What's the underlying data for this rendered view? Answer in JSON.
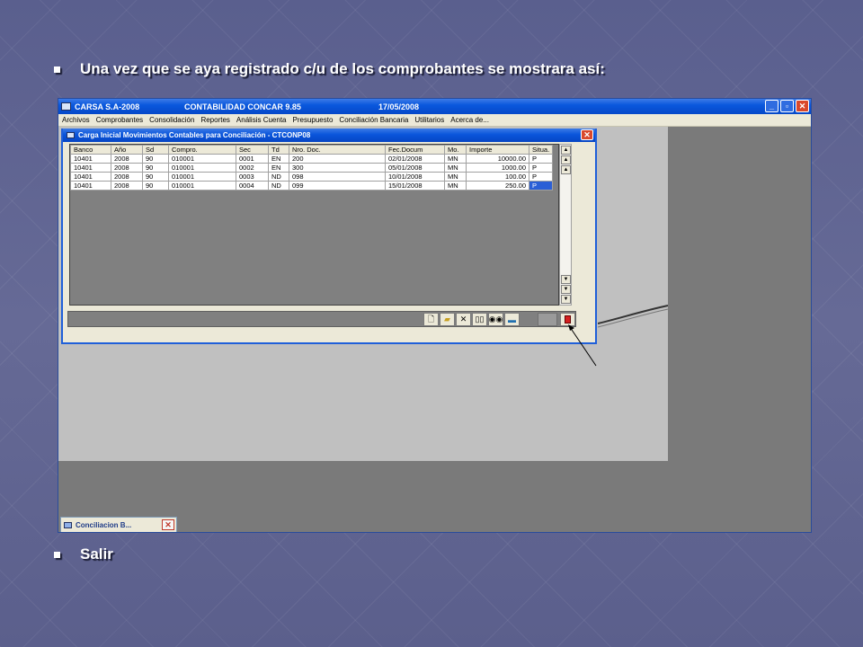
{
  "slide": {
    "bullet1": "Una vez que se aya registrado c/u de los comprobantes se mostrara así:",
    "bullet2": "Salir"
  },
  "app": {
    "title_company": "CARSA S.A-2008",
    "title_system": "CONTABILIDAD CONCAR 9.85",
    "title_date": "17/05/2008",
    "menu": [
      "Archivos",
      "Comprobantes",
      "Consolidación",
      "Reportes",
      "Análisis Cuenta",
      "Presupuesto",
      "Conciliación Bancaria",
      "Utilitarios",
      "Acerca de..."
    ]
  },
  "dialog": {
    "title": "Carga Inicial Movimientos Contables para Conciliación - CTCONP08",
    "columns": [
      "Banco",
      "Año",
      "Sd",
      "Compro.",
      "Sec",
      "Td",
      "Nro. Doc.",
      "Fec.Docum",
      "Mo.",
      "Importe",
      "Situa."
    ],
    "rows": [
      [
        "10401",
        "2008",
        "90",
        "010001",
        "0001",
        "EN",
        "200",
        "02/01/2008",
        "MN",
        "10000.00",
        "P"
      ],
      [
        "10401",
        "2008",
        "90",
        "010001",
        "0002",
        "EN",
        "300",
        "05/01/2008",
        "MN",
        "1000.00",
        "P"
      ],
      [
        "10401",
        "2008",
        "90",
        "010001",
        "0003",
        "ND",
        "098",
        "10/01/2008",
        "MN",
        "100.00",
        "P"
      ],
      [
        "10401",
        "2008",
        "90",
        "010001",
        "0004",
        "ND",
        "099",
        "15/01/2008",
        "MN",
        "250.00",
        "P"
      ]
    ]
  },
  "taskbar": {
    "tab_label": "Conciliacion B..."
  },
  "icons": {
    "toolbar": [
      "new-icon",
      "open-folder-icon",
      "delete-icon",
      "book-icon",
      "binoculars-icon",
      "print-icon"
    ],
    "exit": "exit-door-icon"
  }
}
